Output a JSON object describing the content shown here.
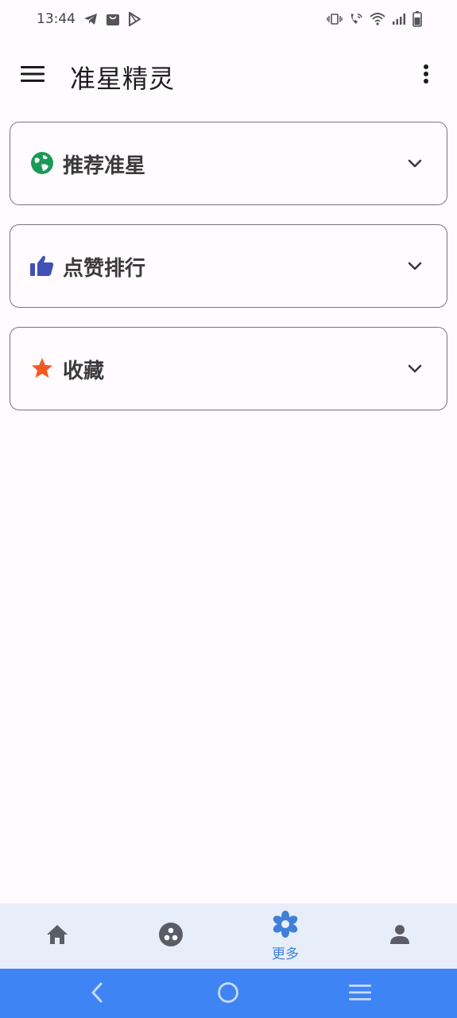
{
  "status_bar": {
    "time": "13:44"
  },
  "app_bar": {
    "title": "准星精灵",
    "menu_icon": "hamburger-menu-icon",
    "more_icon": "more-vert-icon"
  },
  "cards": [
    {
      "label": "推荐准星",
      "icon": "globe-icon",
      "icon_color": "#1a9a57"
    },
    {
      "label": "点赞排行",
      "icon": "thumb-up-icon",
      "icon_color": "#3f51b5"
    },
    {
      "label": "收藏",
      "icon": "star-icon",
      "icon_color": "#f05a22"
    }
  ],
  "bottom_nav": {
    "items": [
      {
        "icon": "home-icon",
        "label": ""
      },
      {
        "icon": "bubble-chart-icon",
        "label": ""
      },
      {
        "icon": "flower-icon",
        "label": "更多",
        "active": true
      },
      {
        "icon": "person-icon",
        "label": ""
      }
    ],
    "active_color": "#3f7fd8",
    "inactive_color": "#5a5d66"
  },
  "system_nav": {
    "background": "#3f84f4"
  }
}
